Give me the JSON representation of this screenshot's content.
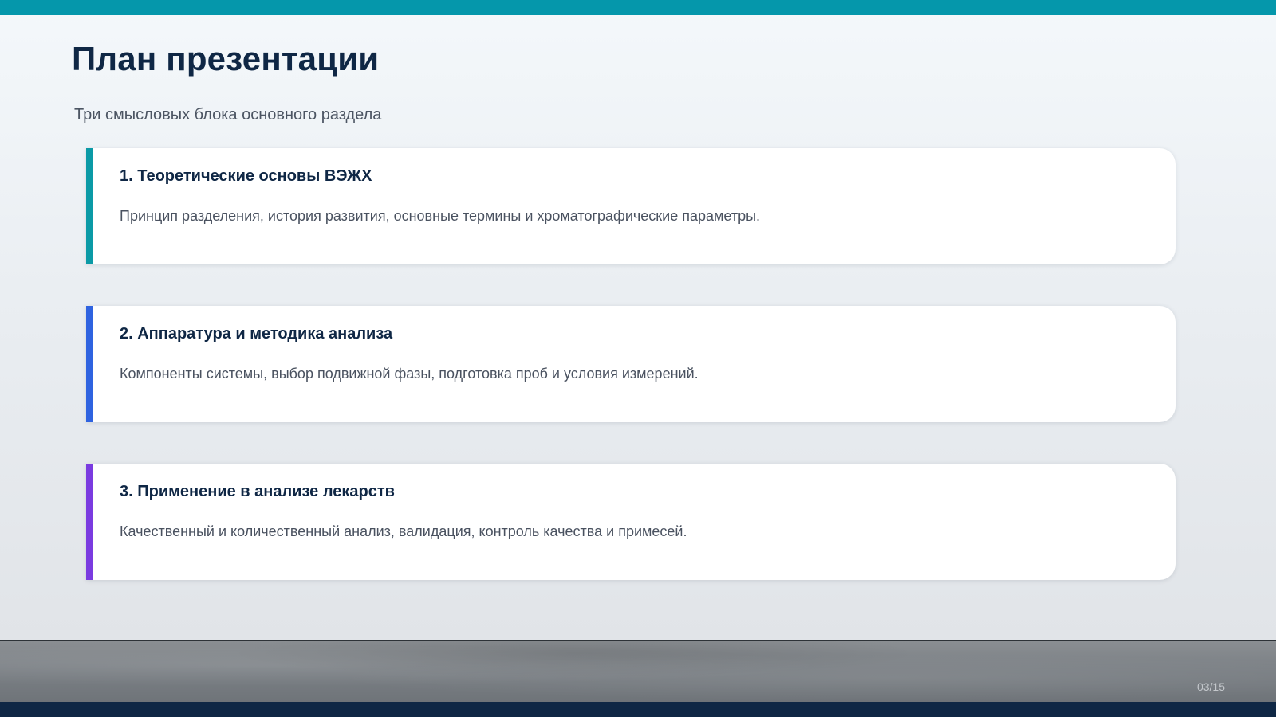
{
  "slide": {
    "title": "План презентации",
    "subtitle": "Три смысловых блока основного раздела",
    "page_indicator": "03/15"
  },
  "cards": [
    {
      "title": "1. Теоретические основы ВЭЖХ",
      "description": "Принцип разделения, история развития, основные термины и хроматографические параметры.",
      "accent_color": "#0b9aa6"
    },
    {
      "title": "2. Аппаратура и методика анализа",
      "description": "Компоненты системы, выбор подвижной фазы, подготовка проб и условия измерений.",
      "accent_color": "#2f63e0"
    },
    {
      "title": "3. Применение в анализе лекарств",
      "description": "Качественный и количественный анализ, валидация, контроль качества и примесей.",
      "accent_color": "#7a3be0"
    }
  ],
  "colors": {
    "top_bar": "#0597ab",
    "bottom_bar": "#0f2745",
    "title_text": "#0f2745"
  }
}
